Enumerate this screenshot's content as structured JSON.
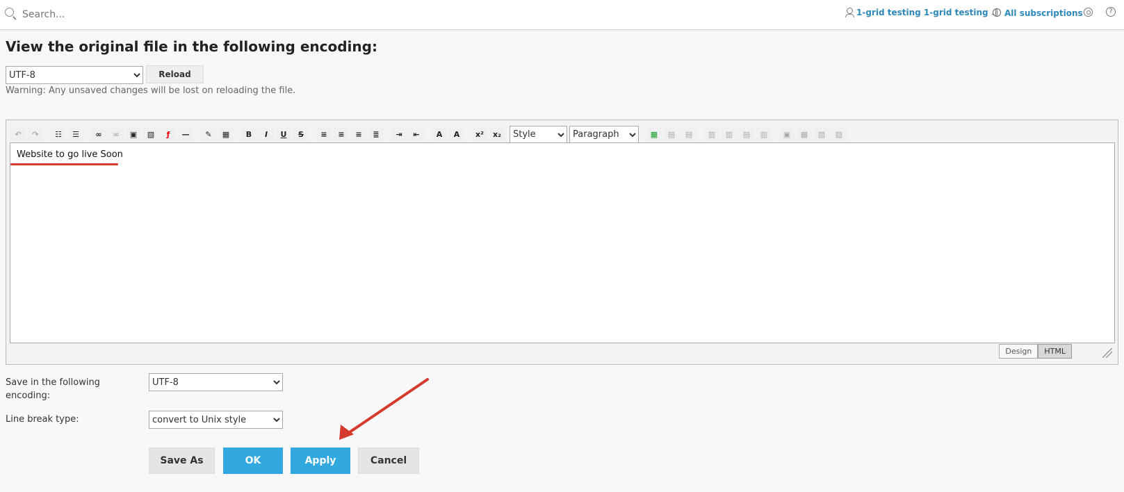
{
  "header": {
    "search_placeholder": "Search...",
    "user_label": "1-grid testing 1-grid testing",
    "subscriptions_label": "All subscriptions"
  },
  "page": {
    "title": "View the original file in the following encoding:",
    "encoding_value": "UTF-8",
    "reload_label": "Reload",
    "warning": "Warning: Any unsaved changes will be lost on reloading the file."
  },
  "editor": {
    "style_value": "Style",
    "paragraph_value": "Paragraph",
    "content": "Website to go live Soon",
    "tabs": [
      "Design",
      "HTML"
    ],
    "active_tab": "HTML"
  },
  "form": {
    "save_encoding_label": "Save in the following encoding:",
    "save_encoding_value": "UTF-8",
    "line_break_label": "Line break type:",
    "line_break_value": "convert to Unix style",
    "buttons": {
      "save_as": "Save As",
      "ok": "OK",
      "apply": "Apply",
      "cancel": "Cancel"
    }
  },
  "colors": {
    "accent": "#32a8e0",
    "link": "#2d89ba",
    "annotation": "#d43a2e"
  }
}
